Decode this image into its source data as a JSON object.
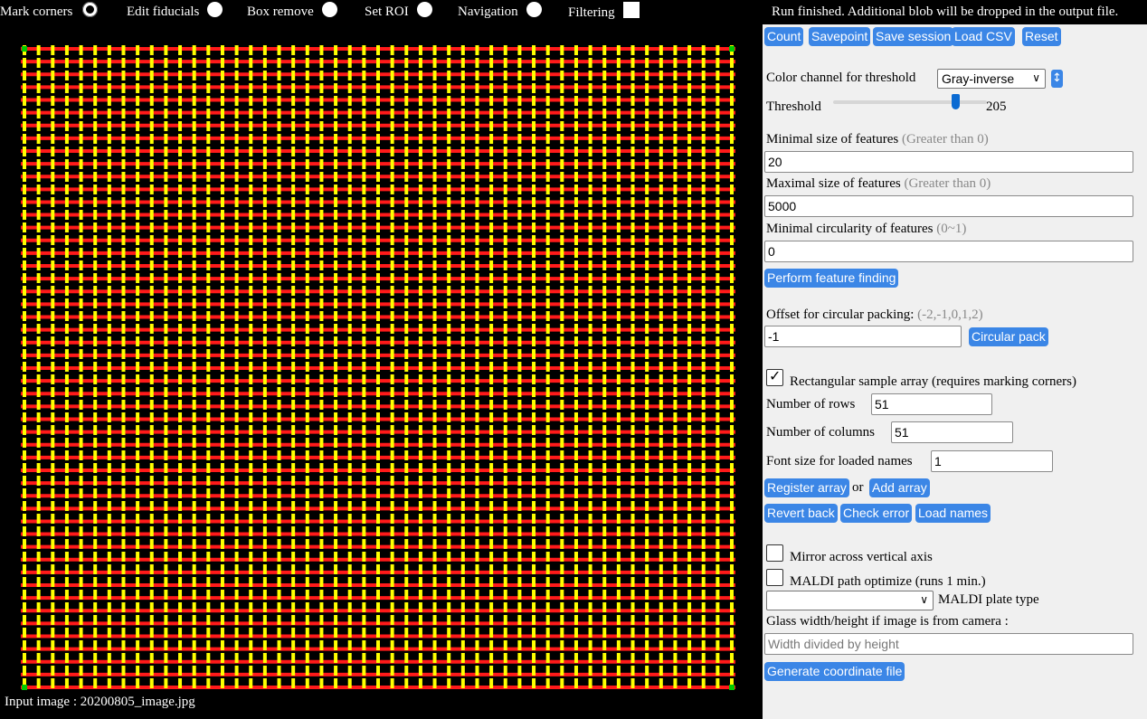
{
  "modes": {
    "mark_corners": "Mark corners",
    "edit_fiducials": "Edit fiducials",
    "box_remove": "Box remove",
    "set_roi": "Set ROI",
    "navigation": "Navigation",
    "filtering": "Filtering",
    "selected": "mark_corners"
  },
  "image": {
    "caption": "Input image : 20200805_image.jpg",
    "grid_rows": 51,
    "grid_cols": 51,
    "colors": {
      "background": "#000000",
      "horizontal": "#ff1a1a",
      "vertical": "#ffff00",
      "corners": "#00cc00"
    }
  },
  "status": "Run finished. Additional blob will be dropped in the output file.",
  "toolbar": {
    "count": "Count",
    "savepoint": "Savepoint",
    "save_session": "Save session",
    "load_csv": "Load CSV",
    "reset": "Reset"
  },
  "threshold": {
    "channel_label": "Color channel for threshold",
    "channel_value": "Gray-inverse",
    "label": "Threshold",
    "value": "205",
    "level": 205,
    "max": 255
  },
  "features": {
    "min_size_label": "Minimal size of features",
    "min_size_hint": "(Greater than 0)",
    "min_size_value": "20",
    "max_size_label": "Maximal size of features",
    "max_size_hint": "(Greater than 0)",
    "max_size_value": "5000",
    "circularity_label": "Minimal circularity of features",
    "circularity_hint": "(0~1)",
    "circularity_value": "0",
    "perform_button": "Perform feature finding"
  },
  "packing": {
    "offset_label": "Offset for circular packing:",
    "offset_hint": "(-2,-1,0,1,2)",
    "offset_value": "-1",
    "button": "Circular pack"
  },
  "array": {
    "rect_label": "Rectangular sample array (requires marking corners)",
    "rect_checked": true,
    "rows_label": "Number of rows",
    "rows_value": "51",
    "cols_label": "Number of columns",
    "cols_value": "51",
    "font_label": "Font size for loaded names",
    "font_value": "1",
    "register": "Register array",
    "or": "or",
    "add": "Add array",
    "revert": "Revert back",
    "check_error": "Check error",
    "load_names": "Load names"
  },
  "output": {
    "mirror_label": "Mirror across vertical axis",
    "mirror_checked": false,
    "maldi_label": "MALDI path optimize (runs 1 min.)",
    "maldi_checked": false,
    "plate_value": "",
    "plate_label": "MALDI plate type",
    "glass_label": "Glass width/height if image is from camera :",
    "glass_placeholder": "Width divided by height",
    "generate": "Generate coordinate file"
  }
}
